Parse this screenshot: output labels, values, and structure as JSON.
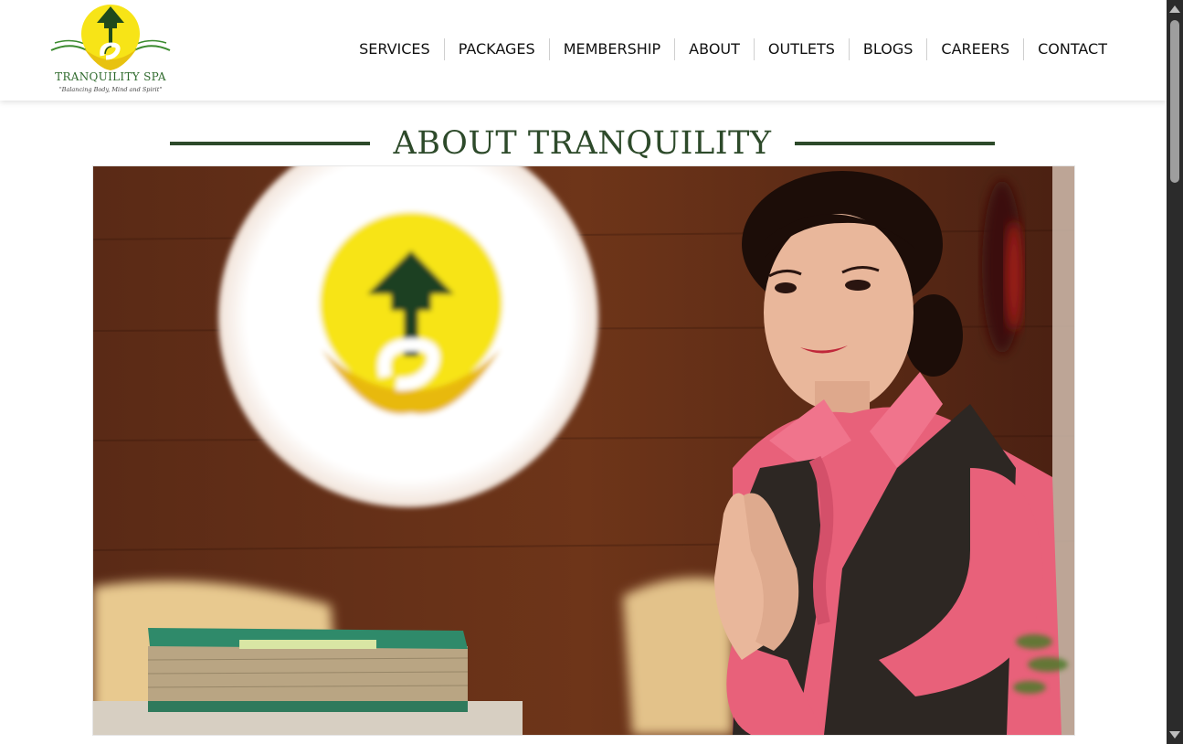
{
  "brand": {
    "name": "TRANQUILITY SPA",
    "tagline": "\"Balancing Body, Mind and Spirit\"",
    "colors": {
      "logo_yellow": "#f7e417",
      "logo_green": "#2e6a2c",
      "heading_green": "#2d4a2a"
    }
  },
  "nav": {
    "items": [
      {
        "label": "SERVICES"
      },
      {
        "label": "PACKAGES"
      },
      {
        "label": "MEMBERSHIP"
      },
      {
        "label": "ABOUT"
      },
      {
        "label": "OUTLETS"
      },
      {
        "label": "BLOGS"
      },
      {
        "label": "CAREERS"
      },
      {
        "label": "CONTACT"
      }
    ]
  },
  "about": {
    "title": "ABOUT TRANQUILITY"
  },
  "icons": {
    "logo": "tranquility-spa-logo",
    "scroll_up": "scroll-up-arrow-icon",
    "scroll_down": "scroll-down-arrow-icon"
  }
}
